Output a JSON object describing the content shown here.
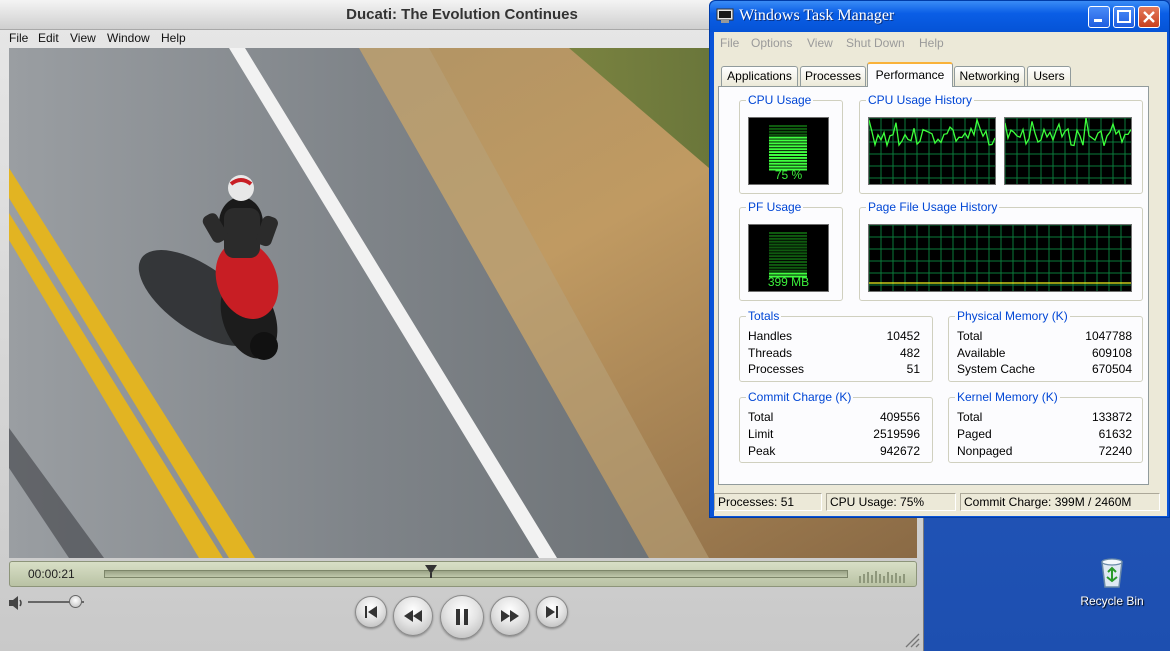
{
  "desktop": {
    "recycle_bin_label": "Recycle Bin"
  },
  "quicktime": {
    "title": "Ducati: The Evolution Continues",
    "menu": [
      "File",
      "Edit",
      "View",
      "Window",
      "Help"
    ],
    "timecode": "00:00:21",
    "progress_fraction": 0.43,
    "volume_fraction": 0.8,
    "state": "playing"
  },
  "taskmanager": {
    "title": "Windows Task Manager",
    "menu": [
      "File",
      "Options",
      "View",
      "Shut Down",
      "Help"
    ],
    "tabs": [
      "Applications",
      "Processes",
      "Performance",
      "Networking",
      "Users"
    ],
    "active_tab": "Performance",
    "cpu_usage": {
      "label": "CPU Usage",
      "value": "75 %",
      "fraction": 0.75
    },
    "cpu_history": {
      "label": "CPU Usage History"
    },
    "pf_usage": {
      "label": "PF Usage",
      "value": "399 MB"
    },
    "pf_history": {
      "label": "Page File Usage History"
    },
    "totals": {
      "label": "Totals",
      "rows": [
        {
          "name": "Handles",
          "value": "10452"
        },
        {
          "name": "Threads",
          "value": "482"
        },
        {
          "name": "Processes",
          "value": "51"
        }
      ]
    },
    "physical_memory": {
      "label": "Physical Memory (K)",
      "rows": [
        {
          "name": "Total",
          "value": "1047788"
        },
        {
          "name": "Available",
          "value": "609108"
        },
        {
          "name": "System Cache",
          "value": "670504"
        }
      ]
    },
    "commit_charge": {
      "label": "Commit Charge (K)",
      "rows": [
        {
          "name": "Total",
          "value": "409556"
        },
        {
          "name": "Limit",
          "value": "2519596"
        },
        {
          "name": "Peak",
          "value": "942672"
        }
      ]
    },
    "kernel_memory": {
      "label": "Kernel Memory (K)",
      "rows": [
        {
          "name": "Total",
          "value": "133872"
        },
        {
          "name": "Paged",
          "value": "61632"
        },
        {
          "name": "Nonpaged",
          "value": "72240"
        }
      ]
    },
    "status": {
      "processes": "Processes: 51",
      "cpu": "CPU Usage: 75%",
      "commit": "Commit Charge: 399M / 2460M"
    }
  }
}
